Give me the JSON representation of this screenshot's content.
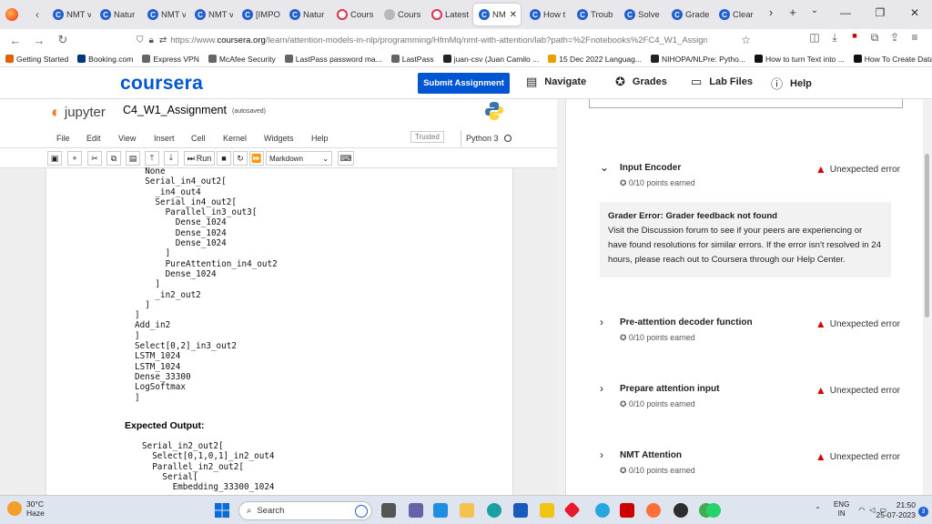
{
  "browser": {
    "tabs": [
      {
        "label": "NMT v",
        "icon": "coursera"
      },
      {
        "label": "Natur",
        "icon": "coursera"
      },
      {
        "label": "NMT v",
        "icon": "coursera"
      },
      {
        "label": "NMT v",
        "icon": "coursera"
      },
      {
        "label": "[IMPO",
        "icon": "coursera"
      },
      {
        "label": "Natur",
        "icon": "coursera"
      },
      {
        "label": "Cours",
        "icon": "red"
      },
      {
        "label": "Cours",
        "icon": "gray"
      },
      {
        "label": "Latest",
        "icon": "red"
      },
      {
        "label": "NM",
        "icon": "coursera",
        "active": true
      },
      {
        "label": "How t",
        "icon": "coursera"
      },
      {
        "label": "Troub",
        "icon": "coursera"
      },
      {
        "label": "Solve",
        "icon": "coursera"
      },
      {
        "label": "Grade",
        "icon": "coursera"
      },
      {
        "label": "Clear",
        "icon": "coursera"
      }
    ],
    "url_prefix": "https://www.",
    "url_host": "coursera.org",
    "url_path": "/learn/attention-models-in-nlp/programming/HfmMq/nmt-with-attention/lab?path=%2Fnotebooks%2FC4_W1_Assignm",
    "bookmarks": [
      {
        "label": "Getting Started",
        "color": "#e66000"
      },
      {
        "label": "Booking.com",
        "color": "#003580"
      },
      {
        "label": "Express VPN",
        "color": "#666"
      },
      {
        "label": "McAfee Security",
        "color": "#666"
      },
      {
        "label": "LastPass password ma...",
        "color": "#666"
      },
      {
        "label": "LastPass",
        "color": "#666"
      },
      {
        "label": "juan-csv (Juan Camilo ...",
        "color": "#222"
      },
      {
        "label": "15 Dec 2022 Languag...",
        "color": "#e8a200"
      },
      {
        "label": "NIHOPA/NLPre: Pytho...",
        "color": "#222"
      },
      {
        "label": "How to turn Text into ...",
        "color": "#111"
      },
      {
        "label": "How To Create Data P...",
        "color": "#111"
      }
    ]
  },
  "coursera": {
    "logo": "coursera",
    "submit_label": "Submit Assignment",
    "nav": [
      {
        "label": "Navigate",
        "icon": "notebook-icon"
      },
      {
        "label": "Grades",
        "icon": "award-icon"
      },
      {
        "label": "Lab Files",
        "icon": "folder-icon"
      },
      {
        "label": "Help",
        "icon": "help-icon"
      }
    ]
  },
  "jupyter": {
    "brand": "jupyter",
    "notebook_name": "C4_W1_Assignment",
    "autosaved": "(autosaved)",
    "menus": [
      "File",
      "Edit",
      "View",
      "Insert",
      "Cell",
      "Kernel",
      "Widgets",
      "Help"
    ],
    "trusted": "Trusted",
    "kernel": "Python 3",
    "run_label": "Run",
    "cell_type": "Markdown",
    "code_top": "  None\n  Serial_in4_out2[\n    _in4_out4\n    Serial_in4_out2[\n      Parallel_in3_out3[\n        Dense_1024\n        Dense_1024\n        Dense_1024\n      ]\n      PureAttention_in4_out2\n      Dense_1024\n    ]\n    _in2_out2\n  ]\n]\nAdd_in2\n]\nSelect[0,2]_in3_out2\nLSTM_1024\nLSTM_1024\nDense_33300\nLogSoftmax\n]",
    "expected_heading": "Expected Output:",
    "code_bottom": "Serial_in2_out2[\n  Select[0,1,0,1]_in2_out4\n  Parallel_in2_out2[\n    Serial[\n      Embedding_33300_1024"
  },
  "grader": {
    "sections": [
      {
        "title": "Input Encoder",
        "points": "0/10 points earned",
        "status": "Unexpected error",
        "expanded": true
      },
      {
        "title": "Pre-attention decoder function",
        "points": "0/10 points earned",
        "status": "Unexpected error",
        "expanded": false
      },
      {
        "title": "Prepare attention input",
        "points": "0/10 points earned",
        "status": "Unexpected error",
        "expanded": false
      },
      {
        "title": "NMT Attention",
        "points": "0/10 points earned",
        "status": "Unexpected error",
        "expanded": false
      }
    ],
    "error_title": "Grader Error: Grader feedback not found",
    "error_body": "Visit the Discussion forum to see if your peers are experiencing or have found resolutions for similar errors. If the error isn't resolved in 24 hours, please reach out to Coursera through our Help Center."
  },
  "taskbar": {
    "weather_temp": "30°C",
    "weather_desc": "Haze",
    "search_placeholder": "Search",
    "lang": "ENG",
    "region": "IN",
    "time": "21:50",
    "date": "25-07-2023",
    "notif_count": "3"
  }
}
